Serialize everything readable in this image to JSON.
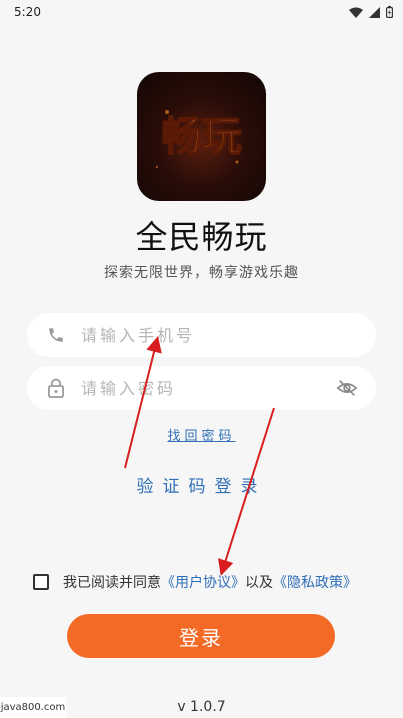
{
  "status_bar": {
    "time": "5:20"
  },
  "app": {
    "logo_text": "畅玩",
    "name": "全民畅玩",
    "slogan": "探索无限世界，畅享游戏乐趣"
  },
  "form": {
    "phone_placeholder": "请输入手机号",
    "password_placeholder": "请输入密码",
    "forgot_label": "找回密码",
    "code_login_label": "验证码登录"
  },
  "agreement": {
    "prefix": "我已阅读并同意",
    "user_agreement": "《用户协议》",
    "and": "以及",
    "privacy_policy": "《隐私政策》"
  },
  "login_button": {
    "label": "登录"
  },
  "footer": {
    "version": "v 1.0.7",
    "watermark": "java800.com"
  },
  "colors": {
    "accent": "#f36a26",
    "link": "#2f6fb8",
    "annotation": "#d81e1e"
  }
}
